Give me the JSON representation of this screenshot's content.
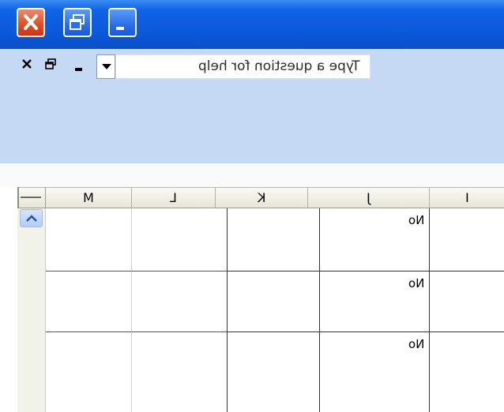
{
  "window": {
    "title_buttons": [
      {
        "name": "close",
        "icon": "close-icon"
      },
      {
        "name": "restore",
        "icon": "restore-icon"
      },
      {
        "name": "minimize",
        "icon": "minimize-icon"
      }
    ]
  },
  "help": {
    "placeholder": "Type a question for help"
  },
  "grid": {
    "columns": [
      "M",
      "L",
      "K",
      "J",
      "I"
    ],
    "rows": [
      [
        "",
        "",
        "",
        "No",
        ""
      ],
      [
        "",
        "",
        "",
        "No",
        ""
      ],
      [
        "",
        "",
        "",
        "No",
        ""
      ]
    ]
  },
  "colors": {
    "titlebar": "#0a58d8",
    "menubar": "#c5d9f5",
    "close_button": "#dd4b26"
  }
}
